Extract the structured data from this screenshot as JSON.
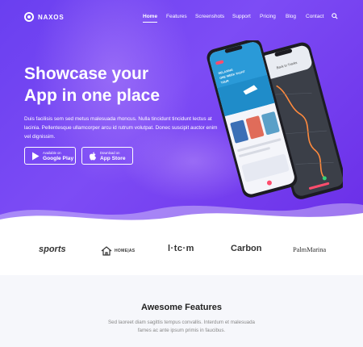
{
  "brand": {
    "name": "NAXOS"
  },
  "nav": {
    "items": [
      {
        "label": "Home",
        "active": true
      },
      {
        "label": "Features"
      },
      {
        "label": "Screenshots"
      },
      {
        "label": "Support"
      },
      {
        "label": "Pricing"
      },
      {
        "label": "Blog"
      },
      {
        "label": "Contact"
      }
    ]
  },
  "hero": {
    "title_line1": "Showcase your",
    "title_line2": "App in one place",
    "lead": "Duis facilisis sem sed metus malesuada rhoncus. Nulla tincidunt tincidunt lectus at lacinia. Pellentesque ullamcorper arcu id rutrum volutpat. Donec suscipit auctor enim vel dignissim.",
    "buttons": {
      "play": {
        "small": "Available on",
        "big": "Google Play",
        "icon": "play-icon"
      },
      "apple": {
        "small": "Download on",
        "big": "App Store",
        "icon": "apple-icon"
      }
    },
    "phone_left": {
      "line1": "RELAXING",
      "line2": "ONE WEEK YACHT",
      "line3": "TOUR"
    },
    "phone_right": {
      "header": "Back to Tracks"
    }
  },
  "clients": [
    {
      "label": "sports"
    },
    {
      "label": "HOME|AS"
    },
    {
      "label": "l·tc·m"
    },
    {
      "label": "Carbon"
    },
    {
      "label": "PalmMarina"
    }
  ],
  "features": {
    "title": "Awesome Features",
    "subtitle": "Sed laoreet diam sagittis tempus convallis. Interdum et malesuada fames ac ante ipsum primis in faucibus."
  },
  "colors": {
    "hero": "#6a3ff0",
    "accent": "#7d4cf5",
    "phone_pink": "#ff4d6d"
  }
}
